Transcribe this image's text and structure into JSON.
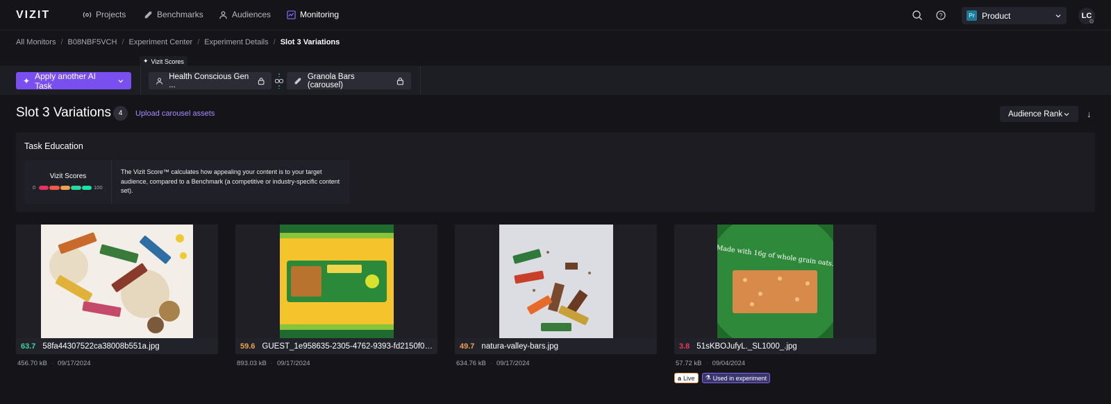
{
  "nav": {
    "logo": "VIZIT",
    "items": [
      {
        "label": "Projects",
        "icon": "projects-icon"
      },
      {
        "label": "Benchmarks",
        "icon": "benchmarks-icon"
      },
      {
        "label": "Audiences",
        "icon": "audiences-icon"
      },
      {
        "label": "Monitoring",
        "icon": "monitoring-icon",
        "active": true
      }
    ],
    "product_badge": "Pr",
    "product_label": "Product",
    "avatar": "LC"
  },
  "breadcrumb": [
    "All Monitors",
    "B08NBF5VCH",
    "Experiment Center",
    "Experiment Details",
    "Slot 3 Variations"
  ],
  "toolbar": {
    "ai_button": "Apply another AI Task",
    "vizit_tag": "Vizit Scores",
    "audience_chip": "Health Conscious Gen ...",
    "benchmark_chip": "Granola Bars (carousel)"
  },
  "section": {
    "title": "Slot 3 Variations",
    "count": "4",
    "upload_link": "Upload carousel assets",
    "sort_label": "Audience Rank"
  },
  "education": {
    "title": "Task Education",
    "score_label": "Vizit Scores",
    "scale_min": "0",
    "scale_max": "100",
    "scale_colors": [
      "#e0335e",
      "#ef5a4a",
      "#f2a04b",
      "#28d9a0",
      "#12e8a6"
    ],
    "text": "The Vizit Score™ calculates how appealing your content is to your target audience, compared to a Benchmark (a competitive or industry-specific content set)."
  },
  "cards": [
    {
      "score": "63.7",
      "score_color": "#3fd5a5",
      "filename": "58fa44307522ca38008b551a.jpg",
      "size": "456.70 kB",
      "date": "09/17/2024"
    },
    {
      "score": "59.6",
      "score_color": "#f0a24a",
      "filename": "GUEST_1e958635-2305-4762-9393-fd2150f00...",
      "size": "893.03 kB",
      "date": "09/17/2024"
    },
    {
      "score": "49.7",
      "score_color": "#f0a24a",
      "filename": "natura-valley-bars.jpg",
      "size": "634.76 kB",
      "date": "09/17/2024"
    },
    {
      "score": "3.8",
      "score_color": "#e8385f",
      "filename": "51sKBOJufyL._SL1000_.jpg",
      "size": "57.72 kB",
      "date": "09/04/2024",
      "badge_live": "Live",
      "badge_experiment": "Used in experiment",
      "card4_art_text": "Made with 16g of whole grain oats."
    }
  ]
}
